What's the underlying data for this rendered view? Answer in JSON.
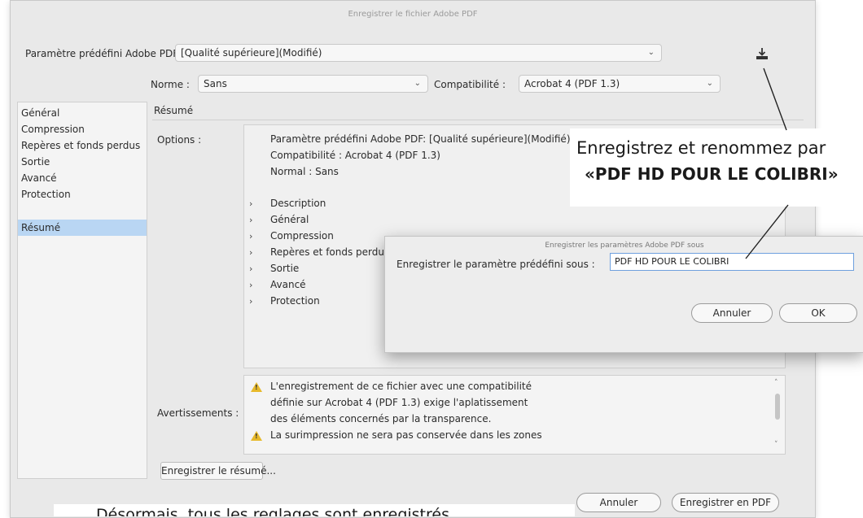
{
  "window": {
    "title": "Enregistrer le fichier Adobe PDF"
  },
  "preset": {
    "label": "Paramètre prédéfini Adobe PDF :",
    "value": "[Qualité supérieure](Modifié)"
  },
  "standard": {
    "label": "Norme :",
    "value": "Sans"
  },
  "compatibility": {
    "label": "Compatibilité :",
    "value": "Acrobat 4 (PDF 1.3)"
  },
  "sidebar": {
    "items": [
      {
        "label": "Général"
      },
      {
        "label": "Compression"
      },
      {
        "label": "Repères et fonds perdus"
      },
      {
        "label": "Sortie"
      },
      {
        "label": "Avancé"
      },
      {
        "label": "Protection"
      },
      {
        "label": "Résumé"
      }
    ]
  },
  "main": {
    "section_title": "Résumé",
    "options_label": "Options :",
    "summary_lines": [
      "Paramètre prédéfini Adobe PDF: [Qualité supérieure](Modifié)",
      "Compatibilité : Acrobat 4 (PDF 1.3)",
      "Normal : Sans"
    ],
    "tree_items": [
      "Description",
      "Général",
      "Compression",
      "Repères et fonds perdus",
      "Sortie",
      "Avancé",
      "Protection"
    ],
    "warnings_label": "Avertissements :",
    "warning_lines": [
      "L'enregistrement de ce fichier avec une compatibilité",
      "définie sur Acrobat 4 (PDF 1.3) exige l'aplatissement",
      "des éléments concernés par la transparence.",
      "La surimpression ne sera pas conservée dans les zones"
    ],
    "save_summary_button": "Enregistrer le résumé...",
    "cancel_button": "Annuler",
    "save_pdf_button": "Enregistrer en PDF"
  },
  "sub_dialog": {
    "title": "Enregistrer les paramètres Adobe PDF sous",
    "field_label": "Enregistrer le paramètre prédéfini sous :",
    "field_value": "PDF HD POUR LE COLIBRI",
    "cancel_button": "Annuler",
    "ok_button": "OK"
  },
  "annotation": {
    "line1": "Enregistrez et renommez par",
    "line2": "«PDF HD POUR LE COLIBRI»"
  },
  "caption": {
    "text": "Désormais, tous les reglages sont enregistrés"
  },
  "icons": {
    "save_preset": "download-icon",
    "dropdown": "chevron-down-icon",
    "warning": "warning-icon"
  },
  "colors": {
    "selection": "#b9d6f3",
    "warning": "#e7b92a"
  }
}
